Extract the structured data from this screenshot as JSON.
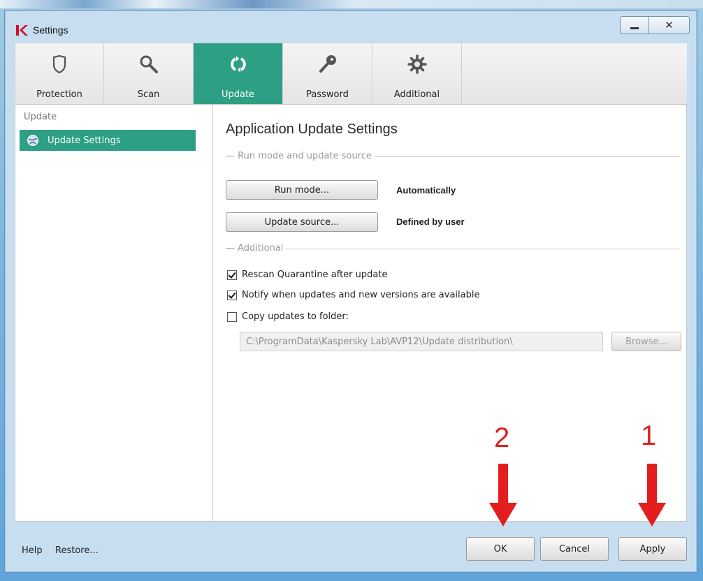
{
  "window": {
    "title": "Settings",
    "controls": {
      "minimize": "—",
      "close": "✕"
    }
  },
  "toolbar": {
    "tabs": [
      {
        "label": "Protection",
        "icon": "shield-icon",
        "active": false
      },
      {
        "label": "Scan",
        "icon": "magnifier-icon",
        "active": false
      },
      {
        "label": "Update",
        "icon": "refresh-icon",
        "active": true
      },
      {
        "label": "Password",
        "icon": "key-icon",
        "active": false
      },
      {
        "label": "Additional",
        "icon": "gear-icon",
        "active": false
      }
    ]
  },
  "sidebar": {
    "heading": "Update",
    "items": [
      {
        "label": "Update Settings",
        "icon": "globe-icon",
        "selected": true
      }
    ]
  },
  "main": {
    "title": "Application Update Settings",
    "group_run": "Run mode and update source",
    "run_mode_button": "Run mode...",
    "run_mode_value": "Automatically",
    "update_source_button": "Update source...",
    "update_source_value": "Defined by user",
    "group_additional": "Additional",
    "checkboxes": [
      {
        "label": "Rescan Quarantine after update",
        "checked": true
      },
      {
        "label": "Notify when updates and new versions are available",
        "checked": true
      },
      {
        "label": "Copy updates to folder:",
        "checked": false
      }
    ],
    "folder_path": "C:\\ProgramData\\Kaspersky Lab\\AVP12\\Update distribution\\",
    "browse_button": "Browse..."
  },
  "footer": {
    "help": "Help",
    "restore": "Restore...",
    "ok": "OK",
    "cancel": "Cancel",
    "apply": "Apply"
  },
  "annotations": {
    "step1": "1",
    "step2": "2",
    "color": "#e02020"
  },
  "colors": {
    "accent": "#2c9f85",
    "window_frame": "#c6def0"
  }
}
